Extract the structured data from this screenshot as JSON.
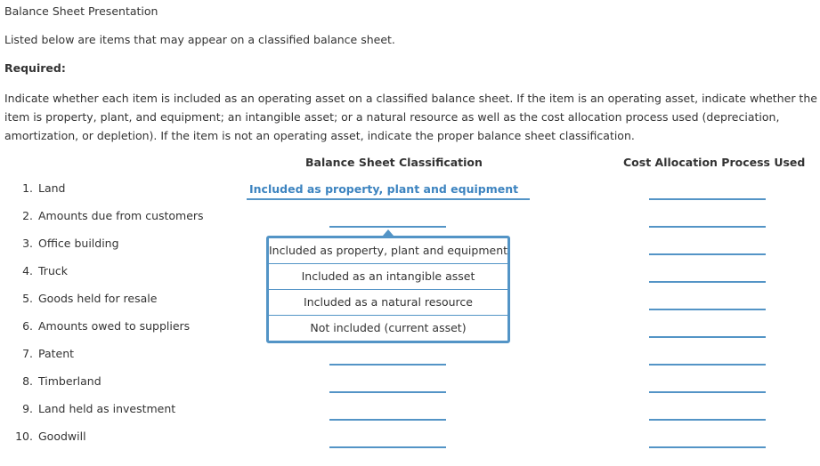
{
  "page": {
    "title": "Balance Sheet Presentation",
    "intro": "Listed below are items that may appear on a classified balance sheet.",
    "required_label": "Required:",
    "instructions": "Indicate whether each item is included as an operating asset on a classified balance sheet. If the item is an operating asset, indicate whether the item is property, plant, and equipment; an intangible asset; or a natural resource as well as the cost allocation process used (depreciation, amortization, or depletion). If the item is not an operating asset, indicate the proper balance sheet classification."
  },
  "table": {
    "headers": {
      "classification": "Balance Sheet Classification",
      "cost_process": "Cost Allocation Process Used"
    },
    "rows": [
      {
        "num": "1.",
        "label": "Land",
        "classification": "Included as property, plant and equipment",
        "cost_process": ""
      },
      {
        "num": "2.",
        "label": "Amounts due from customers",
        "classification": "",
        "cost_process": ""
      },
      {
        "num": "3.",
        "label": "Office building",
        "classification": "",
        "cost_process": ""
      },
      {
        "num": "4.",
        "label": "Truck",
        "classification": "",
        "cost_process": ""
      },
      {
        "num": "5.",
        "label": "Goods held for resale",
        "classification": "",
        "cost_process": ""
      },
      {
        "num": "6.",
        "label": "Amounts owed to suppliers",
        "classification": "",
        "cost_process": ""
      },
      {
        "num": "7.",
        "label": "Patent",
        "classification": "",
        "cost_process": ""
      },
      {
        "num": "8.",
        "label": "Timberland",
        "classification": "",
        "cost_process": ""
      },
      {
        "num": "9.",
        "label": "Land held as investment",
        "classification": "",
        "cost_process": ""
      },
      {
        "num": "10.",
        "label": "Goodwill",
        "classification": "",
        "cost_process": ""
      }
    ]
  },
  "dropdown": {
    "open_for_row": 2,
    "options": [
      "Included as property, plant and equipment",
      "Included as an intangible asset",
      "Included as a natural resource",
      "Not included (current asset)"
    ]
  },
  "colors": {
    "accent": "#5394c6",
    "selected_text": "#3d84c0",
    "text": "#333333"
  }
}
